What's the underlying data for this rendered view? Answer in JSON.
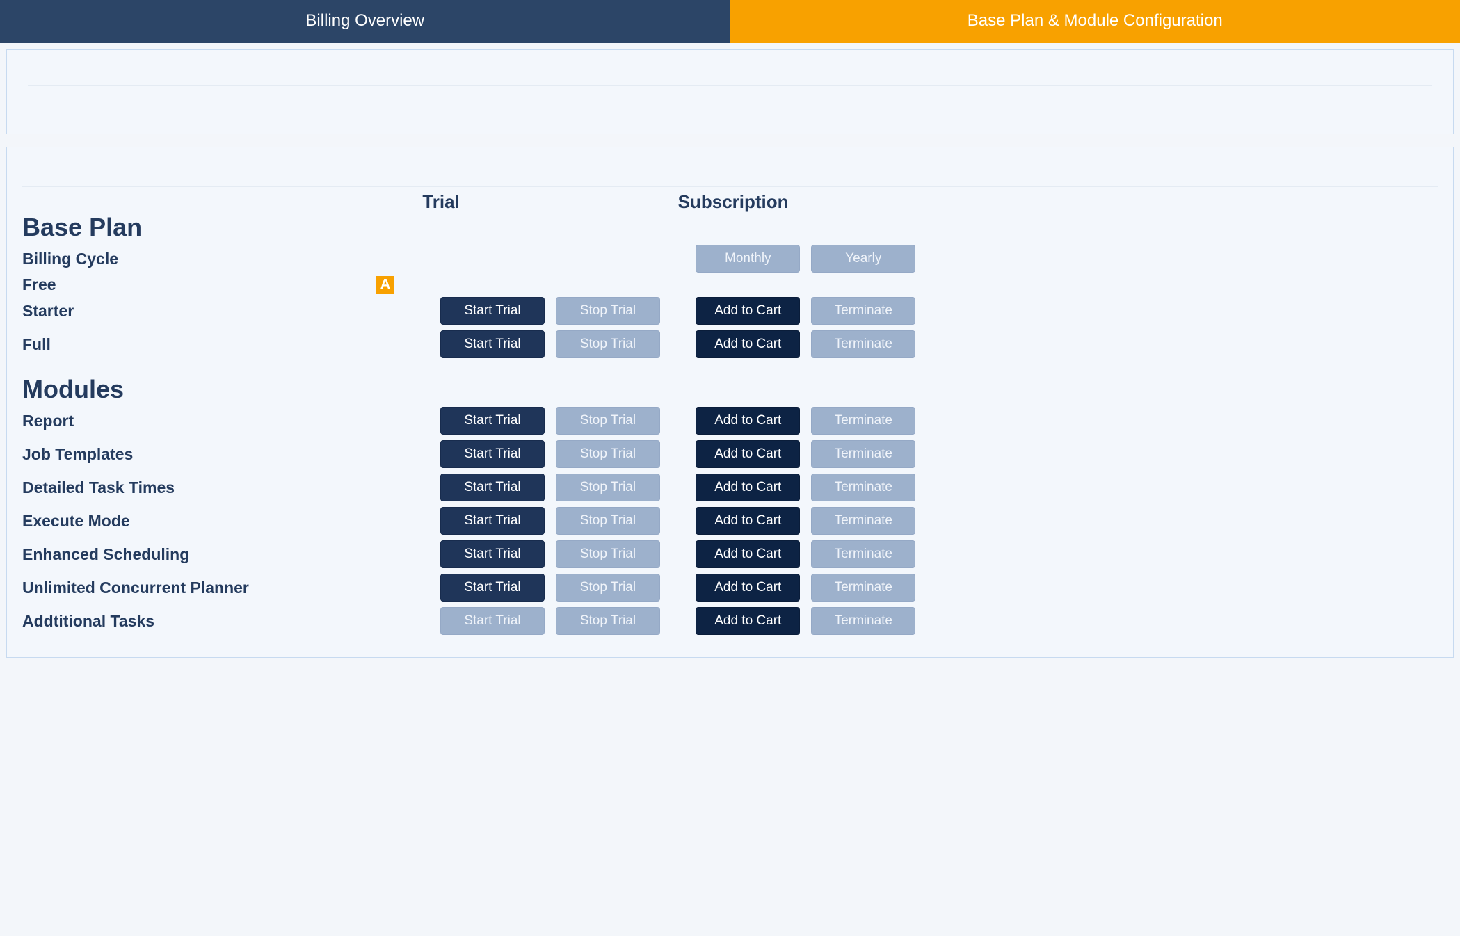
{
  "tabs": {
    "billing_overview": "Billing Overview",
    "base_plan_config": "Base Plan & Module Configuration",
    "active": "base_plan_config"
  },
  "columns": {
    "trial": "Trial",
    "subscription": "Subscription"
  },
  "sections": {
    "base_plan": "Base Plan",
    "modules": "Modules"
  },
  "billing_cycle": {
    "label": "Billing Cycle",
    "monthly": "Monthly",
    "yearly": "Yearly"
  },
  "buttons": {
    "start_trial": "Start Trial",
    "stop_trial": "Stop Trial",
    "add_to_cart": "Add to Cart",
    "terminate": "Terminate"
  },
  "badge": {
    "active_letter": "A"
  },
  "base_plan_rows": [
    {
      "label": "Free",
      "is_active_badge": true,
      "start_trial_enabled": false,
      "stop_trial_enabled": false,
      "add_to_cart_enabled": false,
      "terminate_enabled": false,
      "show_buttons": false
    },
    {
      "label": "Starter",
      "is_active_badge": false,
      "start_trial_enabled": true,
      "stop_trial_enabled": false,
      "add_to_cart_enabled": true,
      "terminate_enabled": false,
      "show_buttons": true
    },
    {
      "label": "Full",
      "is_active_badge": false,
      "start_trial_enabled": true,
      "stop_trial_enabled": false,
      "add_to_cart_enabled": true,
      "terminate_enabled": false,
      "show_buttons": true
    }
  ],
  "module_rows": [
    {
      "label": "Report",
      "start_trial_enabled": true,
      "stop_trial_enabled": false,
      "add_to_cart_enabled": true,
      "terminate_enabled": false
    },
    {
      "label": "Job Templates",
      "start_trial_enabled": true,
      "stop_trial_enabled": false,
      "add_to_cart_enabled": true,
      "terminate_enabled": false
    },
    {
      "label": "Detailed Task Times",
      "start_trial_enabled": true,
      "stop_trial_enabled": false,
      "add_to_cart_enabled": true,
      "terminate_enabled": false
    },
    {
      "label": "Execute Mode",
      "start_trial_enabled": true,
      "stop_trial_enabled": false,
      "add_to_cart_enabled": true,
      "terminate_enabled": false
    },
    {
      "label": "Enhanced Scheduling",
      "start_trial_enabled": true,
      "stop_trial_enabled": false,
      "add_to_cart_enabled": true,
      "terminate_enabled": false
    },
    {
      "label": "Unlimited Concurrent Planner",
      "start_trial_enabled": true,
      "stop_trial_enabled": false,
      "add_to_cart_enabled": true,
      "terminate_enabled": false
    },
    {
      "label": "Addtitional Tasks",
      "start_trial_enabled": false,
      "stop_trial_enabled": false,
      "add_to_cart_enabled": true,
      "terminate_enabled": false
    }
  ]
}
